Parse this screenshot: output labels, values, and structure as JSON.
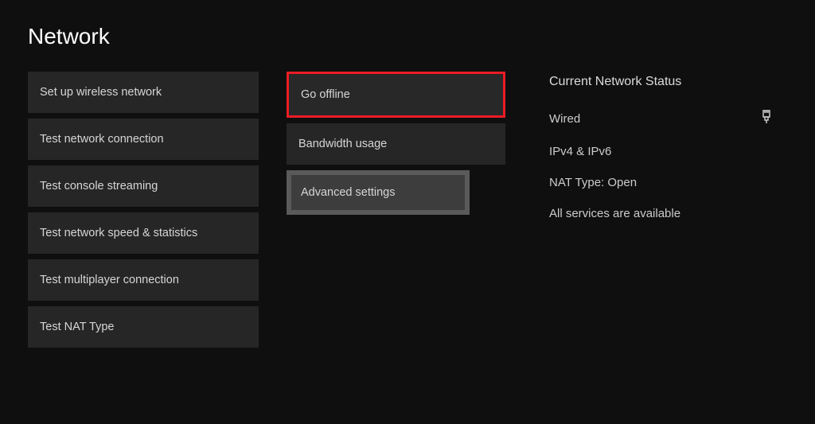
{
  "page_title": "Network",
  "col1": [
    "Set up wireless network",
    "Test network connection",
    "Test console streaming",
    "Test network speed & statistics",
    "Test multiplayer connection",
    "Test NAT Type"
  ],
  "col2": [
    "Go offline",
    "Bandwidth usage",
    "Advanced settings"
  ],
  "status": {
    "heading": "Current Network Status",
    "connection_type": "Wired",
    "ip": "IPv4 & IPv6",
    "nat": "NAT Type: Open",
    "services": "All services are available"
  }
}
